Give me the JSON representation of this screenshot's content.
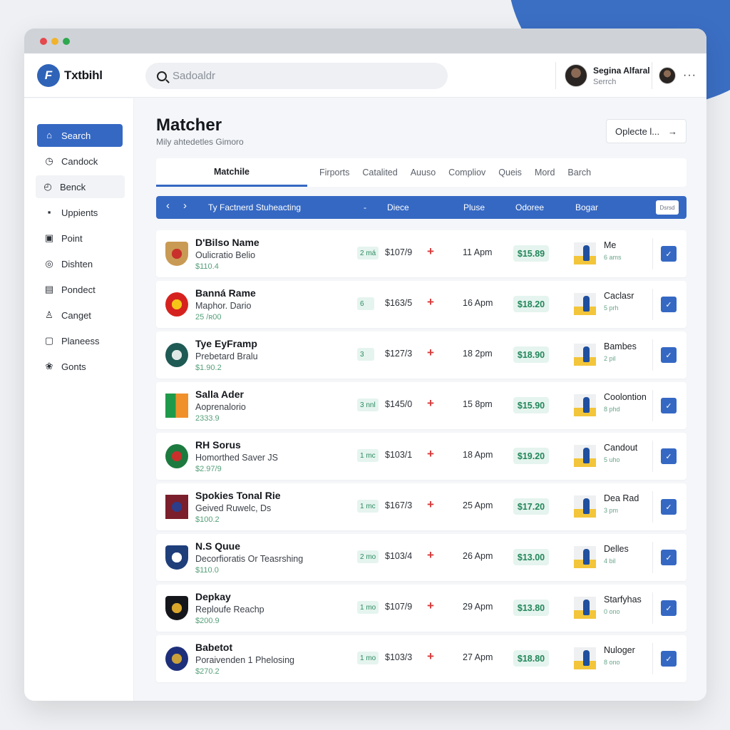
{
  "window": {
    "controls": [
      "close",
      "minimize",
      "maximize"
    ]
  },
  "app": {
    "logo_icon": "brand-logo-icon",
    "name": "Txtbihl"
  },
  "search": {
    "placeholder": "Sadoaldr"
  },
  "user": {
    "name": "Segina Alfaral",
    "subtitle": "Serrch",
    "more_label": "···"
  },
  "sidebar": {
    "items": [
      {
        "label": "Search",
        "icon": "home-icon",
        "glyph": "⌂",
        "active": true
      },
      {
        "label": "Candock",
        "icon": "clock-icon",
        "glyph": "◷"
      },
      {
        "label": "Benck",
        "icon": "history-icon",
        "glyph": "◴"
      },
      {
        "label": "Uppients",
        "icon": "user-filled-icon",
        "glyph": "▪"
      },
      {
        "label": "Point",
        "icon": "chart-box-icon",
        "glyph": "▣"
      },
      {
        "label": "Dishten",
        "icon": "target-icon",
        "glyph": "◎"
      },
      {
        "label": "Pondect",
        "icon": "table-icon",
        "glyph": "▤"
      },
      {
        "label": "Canget",
        "icon": "user-outline-icon",
        "glyph": "♙"
      },
      {
        "label": "Planeess",
        "icon": "lock-icon",
        "glyph": "▢"
      },
      {
        "label": "Gonts",
        "icon": "badge-icon",
        "glyph": "❀"
      }
    ]
  },
  "page": {
    "title": "Matcher",
    "subtitle": "Mily ahtedetles Gimoro",
    "action_label": "Oplecte l...",
    "action_icon": "→"
  },
  "tabs": [
    {
      "label": "Matchile",
      "active": true
    },
    {
      "label": "Firports"
    },
    {
      "label": "Catalited"
    },
    {
      "label": "Auuso"
    },
    {
      "label": "Compliov"
    },
    {
      "label": "Queis"
    },
    {
      "label": "Mord"
    },
    {
      "label": "Barch"
    }
  ],
  "table_header": {
    "prev_icon": "‹",
    "next_icon": "›",
    "title": "Ty Factnerd Stuheacting",
    "dash": "-",
    "col_1": "Diece",
    "col_2": "Pluse",
    "col_3": "Odoree",
    "col_4": "Bogar",
    "button_label": "Dsrsd"
  },
  "rows": [
    {
      "name": "D'Bilso Name",
      "sub": "Oulicratio Belio",
      "price": "$110.4",
      "pill": "2 má",
      "odds": "$107/9",
      "time": "11 Apm",
      "value": "$15.89",
      "label": "Me",
      "label_sub": "6 ams",
      "crest_color": "#c99a53",
      "crest_accent": "#c9302c"
    },
    {
      "name": "Banná Rame",
      "sub": "Maphor. Dario",
      "price": "25 /ʀ00",
      "pill": "6",
      "odds": "$163/5",
      "time": "16 Apm",
      "value": "$18.20",
      "label": "Caclasr",
      "label_sub": "5 prh",
      "crest_color": "#d6221e",
      "crest_accent": "#f5c518"
    },
    {
      "name": "Tye EyFramp",
      "sub": "Prebetard Bralu",
      "price": "$1.90.2",
      "pill": "3",
      "odds": "$127/3",
      "time": "18 2pm",
      "value": "$18.90",
      "label": "Bambes",
      "label_sub": "2 pil",
      "crest_color": "#1f5a55",
      "crest_accent": "#dfe8e6"
    },
    {
      "name": "Salla Ader",
      "sub": "Aoprenalorio",
      "price": "2333.9",
      "pill": "3 nnl",
      "odds": "$145/0",
      "time": "15 8pm",
      "value": "$15.90",
      "label": "Coolontion",
      "label_sub": "8 phd",
      "crest_color": "#1f9a4a",
      "crest_accent": "#f0902a"
    },
    {
      "name": "RH Sorus",
      "sub": "Homorthed Saver JS",
      "price": "$2.97/9",
      "pill": "1 mc",
      "odds": "$103/1",
      "time": "18 Apm",
      "value": "$19.20",
      "label": "Candout",
      "label_sub": "5 uho",
      "crest_color": "#1c7a3e",
      "crest_accent": "#c9302c"
    },
    {
      "name": "Spokies Tonal Rie",
      "sub": "Geived Ruwelc, Ds",
      "price": "$100.2",
      "pill": "1 mc",
      "odds": "$167/3",
      "time": "25 Apm",
      "value": "$17.20",
      "label": "Dea Rad",
      "label_sub": "3 pm",
      "crest_color": "#7a1f2b",
      "crest_accent": "#2c3d8a"
    },
    {
      "name": "N.S Quue",
      "sub": "Decorfioratis Or Teasrshing",
      "price": "$110.0",
      "pill": "2 mo",
      "odds": "$103/4",
      "time": "26 Apm",
      "value": "$13.00",
      "label": "Delles",
      "label_sub": "4 bil",
      "crest_color": "#1f3f7a",
      "crest_accent": "#ffffff"
    },
    {
      "name": "Depkay",
      "sub": "Reploufe Reachp",
      "price": "$200.9",
      "pill": "1 mo",
      "odds": "$107/9",
      "time": "29 Apm",
      "value": "$13.80",
      "label": "Starfyhas",
      "label_sub": "0 ono",
      "crest_color": "#14161c",
      "crest_accent": "#d9a52a"
    },
    {
      "name": "Babetot",
      "sub": "Poraivenden 1 Phelosing",
      "price": "$270.2",
      "pill": "1 mo",
      "odds": "$103/3",
      "time": "27 Apm",
      "value": "$18.80",
      "label": "Nuloger",
      "label_sub": "8 ono",
      "crest_color": "#1d2f7a",
      "crest_accent": "#c9a03a"
    }
  ],
  "icons": {
    "plus": "+",
    "check": "✓"
  },
  "colors": {
    "accent": "#3568c3",
    "positive": "#23865a",
    "negative": "#d63a3a"
  }
}
